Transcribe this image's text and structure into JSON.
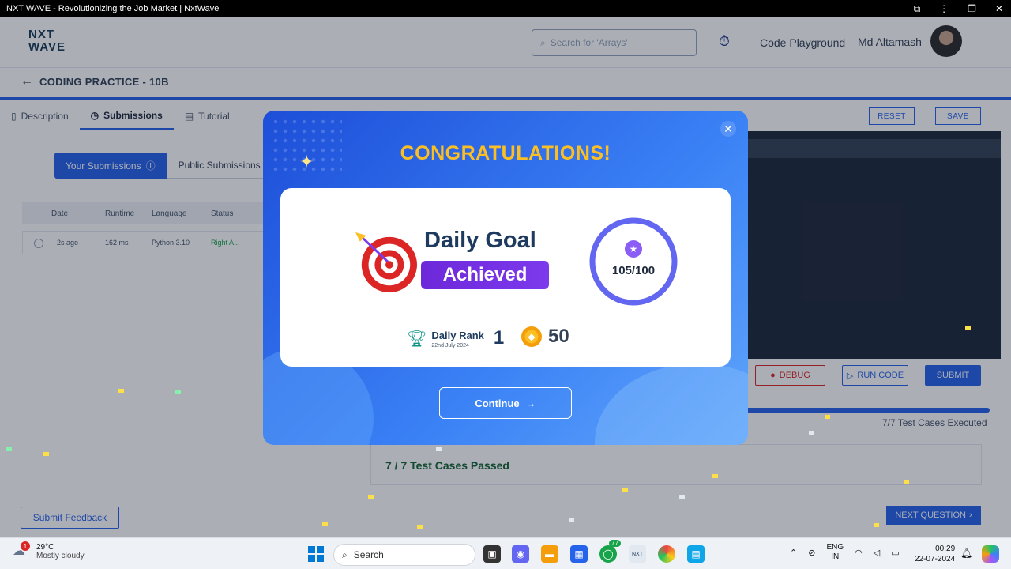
{
  "window": {
    "title": "NXT WAVE - Revolutionizing the Job Market | NxtWave"
  },
  "header": {
    "logo_line1": "NXT",
    "logo_line2": "WAVE",
    "search_placeholder": "Search for 'Arrays'",
    "code_playground": "Code Playground",
    "username": "Md Altamash"
  },
  "practice": {
    "title": "CODING PRACTICE - 10B",
    "tabs": [
      {
        "label": "Description",
        "icon": "document-icon"
      },
      {
        "label": "Submissions",
        "icon": "clock-icon"
      },
      {
        "label": "Tutorial",
        "icon": "book-icon"
      }
    ],
    "submission_toggle": {
      "your": "Your Submissions",
      "public": "Public Submissions"
    },
    "table": {
      "headers": [
        "Date",
        "Runtime",
        "Language",
        "Status"
      ],
      "rows": [
        {
          "date": "2s ago",
          "runtime": "162 ms",
          "language": "Python 3.10",
          "status": "Right A..."
        }
      ]
    },
    "editor_buttons": {
      "reset": "RESET",
      "save": "SAVE",
      "debug": "DEBUG",
      "run_code": "RUN CODE",
      "submit": "SUBMIT"
    },
    "test_cases_executed": "7/7 Test Cases Executed",
    "test_cases_passed": "7 / 7 Test Cases Passed",
    "submit_feedback": "Submit Feedback",
    "next_question": "NEXT QUESTION"
  },
  "modal": {
    "heading": "CONGRATULATIONS!",
    "goal_title": "Daily Goal",
    "goal_status": "Achieved",
    "progress_text": "105/100",
    "progress_fraction": 1.0,
    "rank_label": "Daily Rank",
    "rank_date": "22nd July 2024",
    "rank_value": "1",
    "coins": "50",
    "continue": "Continue",
    "colors": {
      "heading": "#fbbf24",
      "accent": "#7c3aed",
      "bg_start": "#1d4ed8",
      "bg_end": "#60a5fa"
    }
  },
  "taskbar": {
    "temperature": "29°C",
    "weather": "Mostly cloudy",
    "weather_badge": "1",
    "search": "Search",
    "lang_line1": "ENG",
    "lang_line2": "IN",
    "time": "00:29",
    "date": "22-07-2024",
    "whatsapp_badge": "77"
  }
}
